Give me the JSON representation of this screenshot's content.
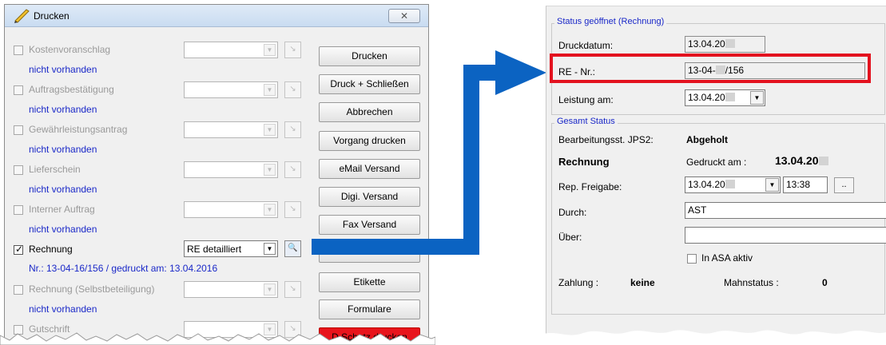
{
  "dialog": {
    "title": "Drucken",
    "close_label": "✕",
    "documents": [
      {
        "label": "Kostenvoranschlag",
        "checked": false,
        "status": "nicht vorhanden",
        "active": false,
        "select_value": ""
      },
      {
        "label": "Auftragsbestätigung",
        "checked": false,
        "status": "nicht vorhanden",
        "active": false,
        "select_value": ""
      },
      {
        "label": "Gewährleistungsantrag",
        "checked": false,
        "status": "nicht vorhanden",
        "active": false,
        "select_value": ""
      },
      {
        "label": "Lieferschein",
        "checked": false,
        "status": "nicht vorhanden",
        "active": false,
        "select_value": ""
      },
      {
        "label": "Interner Auftrag",
        "checked": false,
        "status": "nicht vorhanden",
        "active": false,
        "select_value": ""
      },
      {
        "label": "Rechnung",
        "checked": true,
        "status": "Nr.: 13-04-16/156 / gedruckt am: 13.04.2016",
        "active": true,
        "select_value": "RE detailliert"
      },
      {
        "label": "Rechnung (Selbstbeteiligung)",
        "checked": false,
        "status": "nicht vorhanden",
        "active": false,
        "select_value": ""
      },
      {
        "label": "Gutschrift",
        "checked": false,
        "status": "",
        "active": false,
        "select_value": ""
      }
    ],
    "buttons": [
      {
        "label": "Drucken"
      },
      {
        "label": "Druck + Schließen"
      },
      {
        "label": "Abbrechen"
      },
      {
        "label": "Vorgang drucken"
      },
      {
        "label": "eMail Versand"
      },
      {
        "label": "Digi. Versand"
      },
      {
        "label": "Fax Versand"
      },
      {
        "label": ""
      },
      {
        "label": "Etikette"
      },
      {
        "label": "Formulare"
      },
      {
        "label": "D.Schutz drucken"
      }
    ]
  },
  "panel": {
    "status_group": {
      "title": "Status geöffnet (Rechnung)",
      "druckdatum_label": "Druckdatum:",
      "druckdatum_value": "13.04.20",
      "re_nr_label": "RE - Nr.:",
      "re_nr_prefix": "13-04-",
      "re_nr_suffix": "/156",
      "leistung_label": "Leistung am:",
      "leistung_value": "13.04.20"
    },
    "gesamt_group": {
      "title": "Gesamt Status",
      "bearb_label": "Bearbeitungsst. JPS2:",
      "bearb_value": "Abgeholt",
      "rechnung_label": "Rechnung",
      "gedruckt_label": "Gedruckt am :",
      "gedruckt_value": "13.04.20",
      "rep_label": "Rep. Freigabe:",
      "rep_date": "13.04.20",
      "rep_time": "13:38",
      "rep_btn": "..",
      "durch_label": "Durch:",
      "durch_value": "AST",
      "ueber_label": "Über:",
      "ueber_value": "",
      "asa_label": "In ASA aktiv",
      "zahlung_label": "Zahlung :",
      "zahlung_value": "keine",
      "mahn_label": "Mahnstatus :",
      "mahn_value": "0"
    }
  },
  "colors": {
    "arrow": "#0b63c2",
    "highlight": "#e3121f",
    "link_blue": "#1a28c8"
  }
}
